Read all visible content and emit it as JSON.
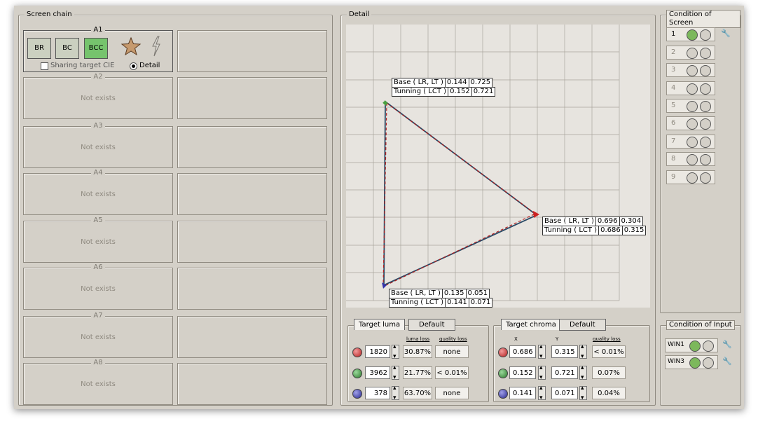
{
  "screen_chain": {
    "title": "Screen chain",
    "a1": {
      "title": "A1",
      "modes": [
        "BR",
        "BC",
        "BCC"
      ],
      "active_mode": "BCC",
      "sharing_label": "Sharing target CIE",
      "detail_label": "Detail"
    },
    "slots": [
      {
        "title": "A2",
        "status": "Not exists"
      },
      {
        "title": "A3",
        "status": "Not exists"
      },
      {
        "title": "A4",
        "status": "Not exists"
      },
      {
        "title": "A5",
        "status": "Not exists"
      },
      {
        "title": "A6",
        "status": "Not exists"
      },
      {
        "title": "A7",
        "status": "Not exists"
      },
      {
        "title": "A8",
        "status": "Not exists"
      }
    ]
  },
  "detail": {
    "title": "Detail",
    "points": [
      {
        "base_label": "Base ( LR, LT )",
        "base_x": "0.144",
        "base_y": "0.725",
        "tuning_label": "Tunning ( LCT )",
        "tuning_x": "0.152",
        "tuning_y": "0.721"
      },
      {
        "base_label": "Base ( LR, LT )",
        "base_x": "0.696",
        "base_y": "0.304",
        "tuning_label": "Tunning ( LCT )",
        "tuning_x": "0.686",
        "tuning_y": "0.315"
      },
      {
        "base_label": "Base ( LR, LT )",
        "base_x": "0.135",
        "base_y": "0.051",
        "tuning_label": "Tunning ( LCT )",
        "tuning_x": "0.141",
        "tuning_y": "0.071"
      }
    ],
    "colors": {
      "base_line": "#2a4a66",
      "tuning_line": "#b02020",
      "green": "#4aa040",
      "red": "#cc2222",
      "blue": "#3333aa"
    }
  },
  "target_luma": {
    "tab_label": "Target luma",
    "default_label": "Default",
    "luma_loss_header": "luma loss",
    "quality_loss_header": "quality loss",
    "rows": [
      {
        "color": "red",
        "value": "1820",
        "luma_loss": "30.87%",
        "quality_loss": "none"
      },
      {
        "color": "green",
        "value": "3962",
        "luma_loss": "21.77%",
        "quality_loss": "< 0.01%"
      },
      {
        "color": "blue",
        "value": "378",
        "luma_loss": "63.70%",
        "quality_loss": "none"
      }
    ]
  },
  "target_chroma": {
    "tab_label": "Target chroma",
    "default_label": "Default",
    "x_header": "X",
    "y_header": "Y",
    "quality_loss_header": "quality loss",
    "rows": [
      {
        "color": "red",
        "x": "0.686",
        "y": "0.315",
        "quality_loss": "< 0.01%"
      },
      {
        "color": "green",
        "x": "0.152",
        "y": "0.721",
        "quality_loss": "0.07%"
      },
      {
        "color": "blue",
        "x": "0.141",
        "y": "0.071",
        "quality_loss": "0.04%"
      }
    ]
  },
  "condition_of_screen": {
    "title": "Condition of Screen",
    "rows": [
      "1",
      "2",
      "3",
      "4",
      "5",
      "6",
      "7",
      "8",
      "9"
    ],
    "active_row": "1"
  },
  "condition_of_input": {
    "title": "Condition of Input",
    "rows": [
      "WIN1",
      "WIN3"
    ]
  }
}
